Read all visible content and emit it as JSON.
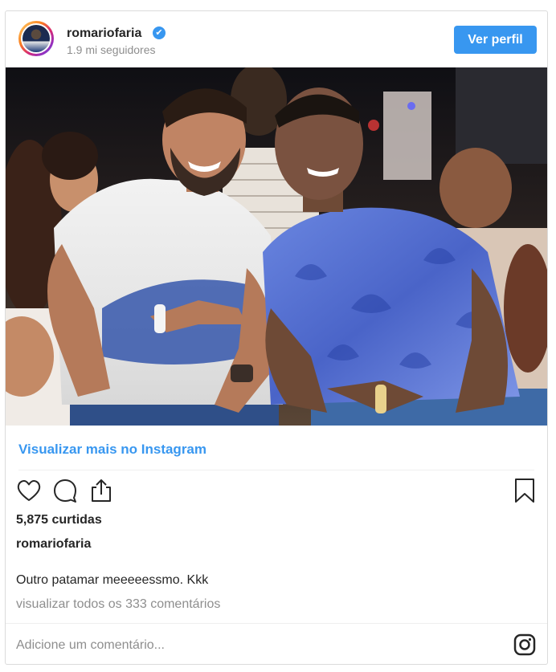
{
  "header": {
    "username": "romariofaria",
    "verified_glyph": "✔",
    "followers": "1.9 mi seguidores",
    "view_profile_label": "Ver perfil"
  },
  "photo": {
    "icon": "photo-two-men"
  },
  "post": {
    "more_link": "Visualizar mais no Instagram",
    "likes": "5,875 curtidas",
    "caption_user": "romariofaria",
    "caption_text": "Outro patamar meeeeessmo. Kkk",
    "comments_link": "visualizar todos os 333 comentários"
  },
  "actions": {
    "like_icon": "heart-icon",
    "comment_icon": "comment-icon",
    "share_icon": "share-icon",
    "save_icon": "bookmark-icon"
  },
  "comment_box": {
    "placeholder": "Adicione um comentário..."
  },
  "colors": {
    "accent": "#3897f0",
    "text": "#262626",
    "muted": "#8e8e8e",
    "border": "#dbdbdb"
  }
}
